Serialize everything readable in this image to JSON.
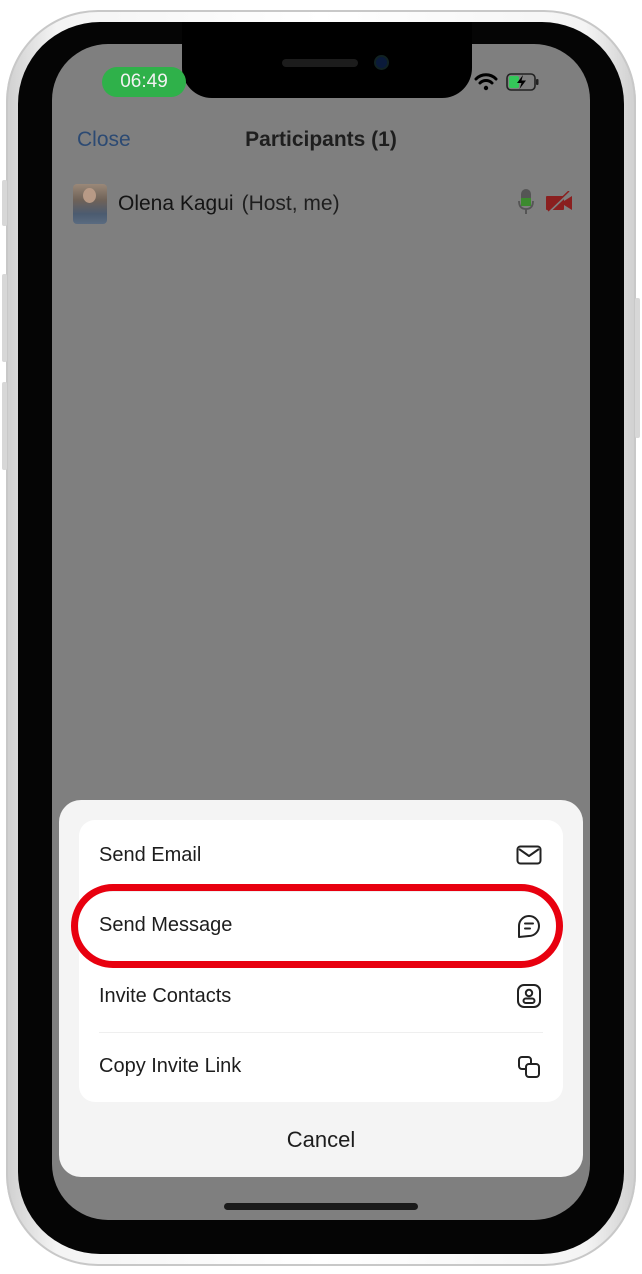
{
  "status_bar": {
    "time": "06:49",
    "time_pill_color": "#2fb14a",
    "icons": [
      "wifi-icon",
      "battery-charging-icon"
    ]
  },
  "nav": {
    "close_label": "Close",
    "title": "Participants (1)",
    "close_color": "#2c4a73"
  },
  "participants": [
    {
      "name": "Olena Kagui",
      "role": "(Host, me)",
      "audio": "mic-on",
      "video": "camera-off"
    }
  ],
  "action_sheet": {
    "items": [
      {
        "label": "Send Email",
        "icon": "envelope-icon"
      },
      {
        "label": "Send Message",
        "icon": "chat-bubble-icon",
        "highlighted": true
      },
      {
        "label": "Invite Contacts",
        "icon": "contact-card-icon"
      },
      {
        "label": "Copy Invite Link",
        "icon": "copy-icon"
      }
    ],
    "cancel_label": "Cancel"
  },
  "annotation": {
    "highlight_color": "#e8000f",
    "highlighted_item": "Send Message"
  }
}
